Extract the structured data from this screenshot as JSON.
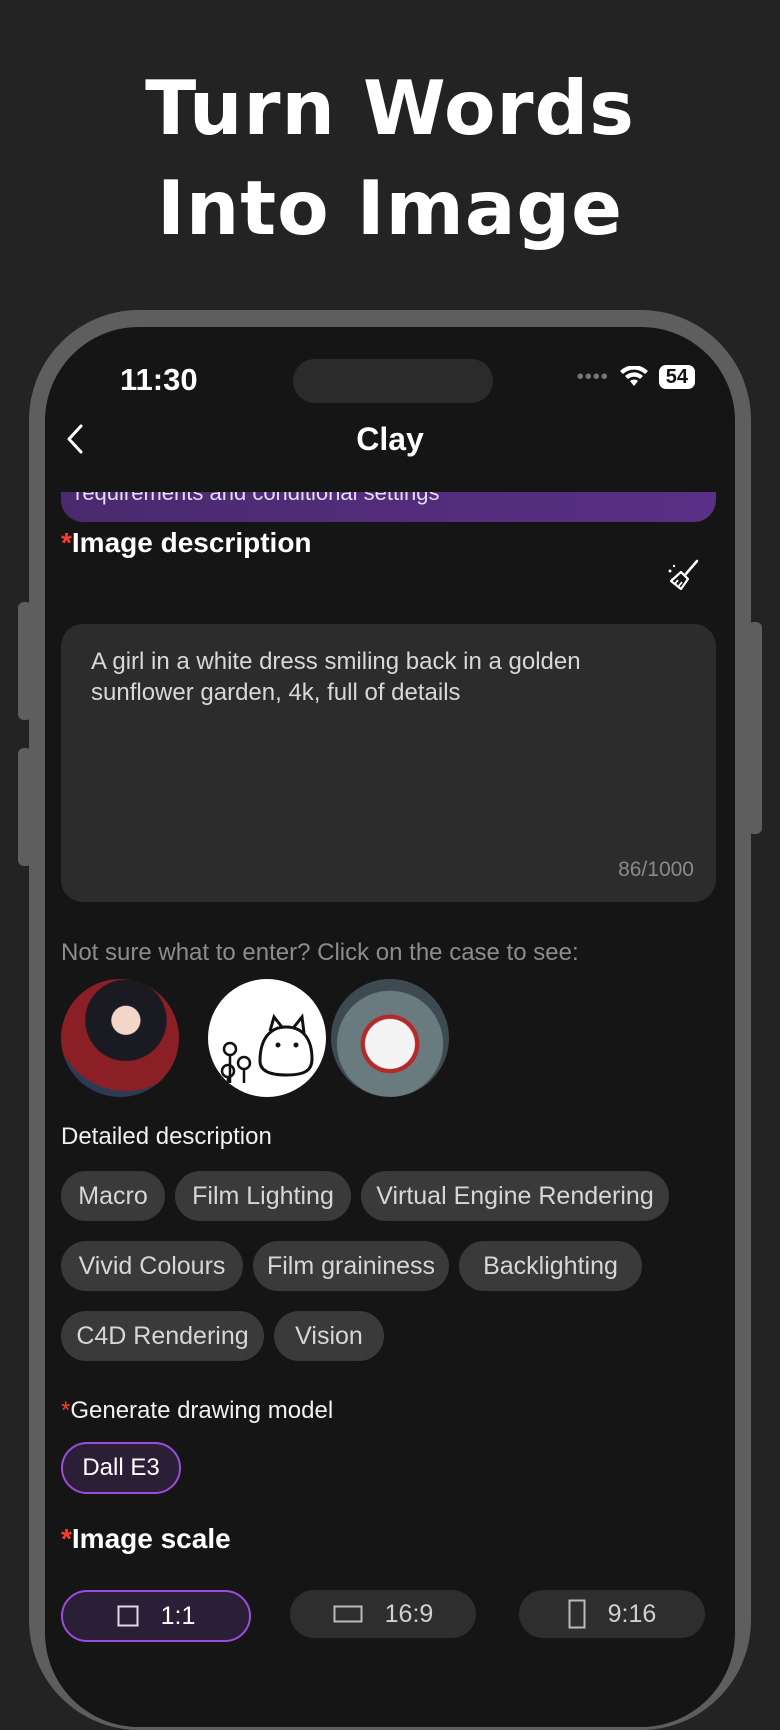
{
  "headline": {
    "line1": "Turn Words",
    "line2": "Into Image"
  },
  "status": {
    "time": "11:30",
    "battery": "54"
  },
  "nav": {
    "title": "Clay"
  },
  "banner": {
    "text": "requirements and conditional settings"
  },
  "image_description": {
    "required_mark": "*",
    "title": "Image description",
    "text": "A girl in a white dress smiling back in a golden sunflower garden, 4k, full of details",
    "count": "86/1000"
  },
  "hint": "Not sure what to enter? Click on the case to see:",
  "detailed": {
    "label": "Detailed description",
    "chips": [
      "Macro",
      "Film Lighting",
      "Virtual Engine Rendering",
      "Vivid Colours",
      "Film graininess",
      "Backlighting",
      "C4D Rendering",
      "Vision"
    ]
  },
  "model": {
    "required_mark": "*",
    "label": "Generate drawing model",
    "selected": "Dall E3"
  },
  "scale": {
    "required_mark": "*",
    "title": "Image scale",
    "options": [
      "1:1",
      "16:9",
      "9:16"
    ],
    "selected": "1:1"
  },
  "colors": {
    "accent": "#9b4dd8",
    "required": "#ff3b30"
  }
}
